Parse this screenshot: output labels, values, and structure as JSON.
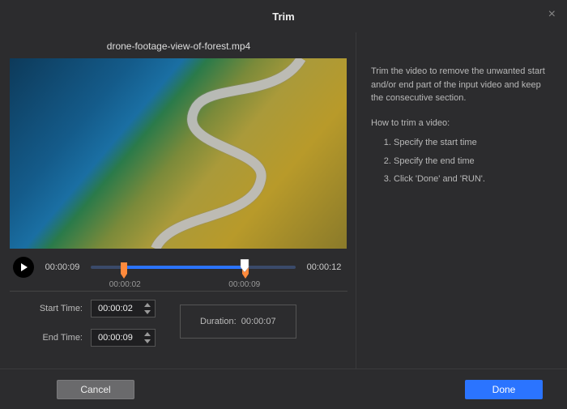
{
  "header": {
    "title": "Trim"
  },
  "file": {
    "name": "drone-footage-view-of-forest.mp4"
  },
  "playback": {
    "current_time": "00:00:09",
    "total_time": "00:00:12"
  },
  "timeline": {
    "start_label": "00:00:02",
    "end_label": "00:00:09",
    "start_pct": 16.7,
    "end_pct": 75,
    "playhead_pct": 75
  },
  "fields": {
    "start_label": "Start Time:",
    "end_label": "End Time:",
    "start_value": "00:00:02",
    "end_value": "00:00:09",
    "duration_label": "Duration:",
    "duration_value": "00:00:07"
  },
  "help": {
    "desc": "Trim the video to remove the unwanted start and/or end part of the input video and keep the consecutive section.",
    "howto_title": "How to trim a video:",
    "steps": [
      "Specify the start time",
      "Specify the end time",
      "Click 'Done' and 'RUN'."
    ]
  },
  "footer": {
    "cancel": "Cancel",
    "done": "Done"
  }
}
